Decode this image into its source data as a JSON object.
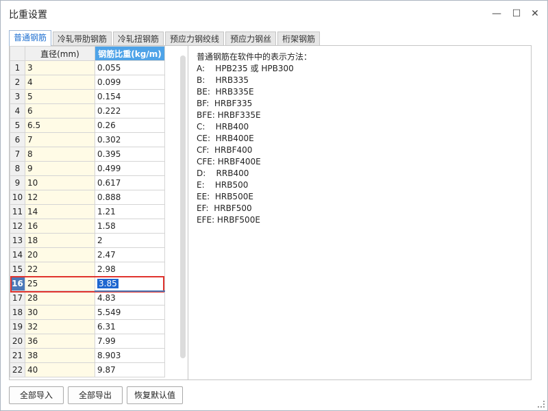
{
  "window": {
    "title": "比重设置",
    "minimize_icon": "—",
    "maximize_icon": "☐",
    "close_icon": "✕"
  },
  "tabs": [
    {
      "label": "普通钢筋",
      "active": true
    },
    {
      "label": "冷轧带肋钢筋",
      "active": false
    },
    {
      "label": "冷轧扭钢筋",
      "active": false
    },
    {
      "label": "预应力钢绞线",
      "active": false
    },
    {
      "label": "预应力钢丝",
      "active": false
    },
    {
      "label": "桁架钢筋",
      "active": false
    }
  ],
  "table": {
    "headers": {
      "diameter": "直径(mm)",
      "weight": "钢筋比重(kg/m)"
    },
    "rows": [
      {
        "num": "1",
        "diameter": "3",
        "weight": "0.055"
      },
      {
        "num": "2",
        "diameter": "4",
        "weight": "0.099"
      },
      {
        "num": "3",
        "diameter": "5",
        "weight": "0.154"
      },
      {
        "num": "4",
        "diameter": "6",
        "weight": "0.222"
      },
      {
        "num": "5",
        "diameter": "6.5",
        "weight": "0.26"
      },
      {
        "num": "6",
        "diameter": "7",
        "weight": "0.302"
      },
      {
        "num": "7",
        "diameter": "8",
        "weight": "0.395"
      },
      {
        "num": "8",
        "diameter": "9",
        "weight": "0.499"
      },
      {
        "num": "9",
        "diameter": "10",
        "weight": "0.617"
      },
      {
        "num": "10",
        "diameter": "12",
        "weight": "0.888"
      },
      {
        "num": "11",
        "diameter": "14",
        "weight": "1.21"
      },
      {
        "num": "12",
        "diameter": "16",
        "weight": "1.58"
      },
      {
        "num": "13",
        "diameter": "18",
        "weight": "2"
      },
      {
        "num": "14",
        "diameter": "20",
        "weight": "2.47"
      },
      {
        "num": "15",
        "diameter": "22",
        "weight": "2.98"
      },
      {
        "num": "16",
        "diameter": "25",
        "weight": "3.85"
      },
      {
        "num": "17",
        "diameter": "28",
        "weight": "4.83"
      },
      {
        "num": "18",
        "diameter": "30",
        "weight": "5.549"
      },
      {
        "num": "19",
        "diameter": "32",
        "weight": "6.31"
      },
      {
        "num": "20",
        "diameter": "36",
        "weight": "7.99"
      },
      {
        "num": "21",
        "diameter": "38",
        "weight": "8.903"
      },
      {
        "num": "22",
        "diameter": "40",
        "weight": "9.87"
      }
    ],
    "selected_row": 15
  },
  "info_lines": [
    "普通钢筋在软件中的表示方法：",
    "A:    HPB235 或 HPB300",
    "B:    HRB335",
    "BE:  HRB335E",
    "BF:  HRBF335",
    "BFE: HRBF335E",
    "C:    HRB400",
    "CE:  HRB400E",
    "CF:  HRBF400",
    "CFE: HRBF400E",
    "D:    RRB400",
    "E:    HRB500",
    "EE:  HRB500E",
    "EF:  HRBF500",
    "EFE: HRBF500E"
  ],
  "buttons": {
    "import_all": "全部导入",
    "export_all": "全部导出",
    "restore_default": "恢复默认值"
  }
}
